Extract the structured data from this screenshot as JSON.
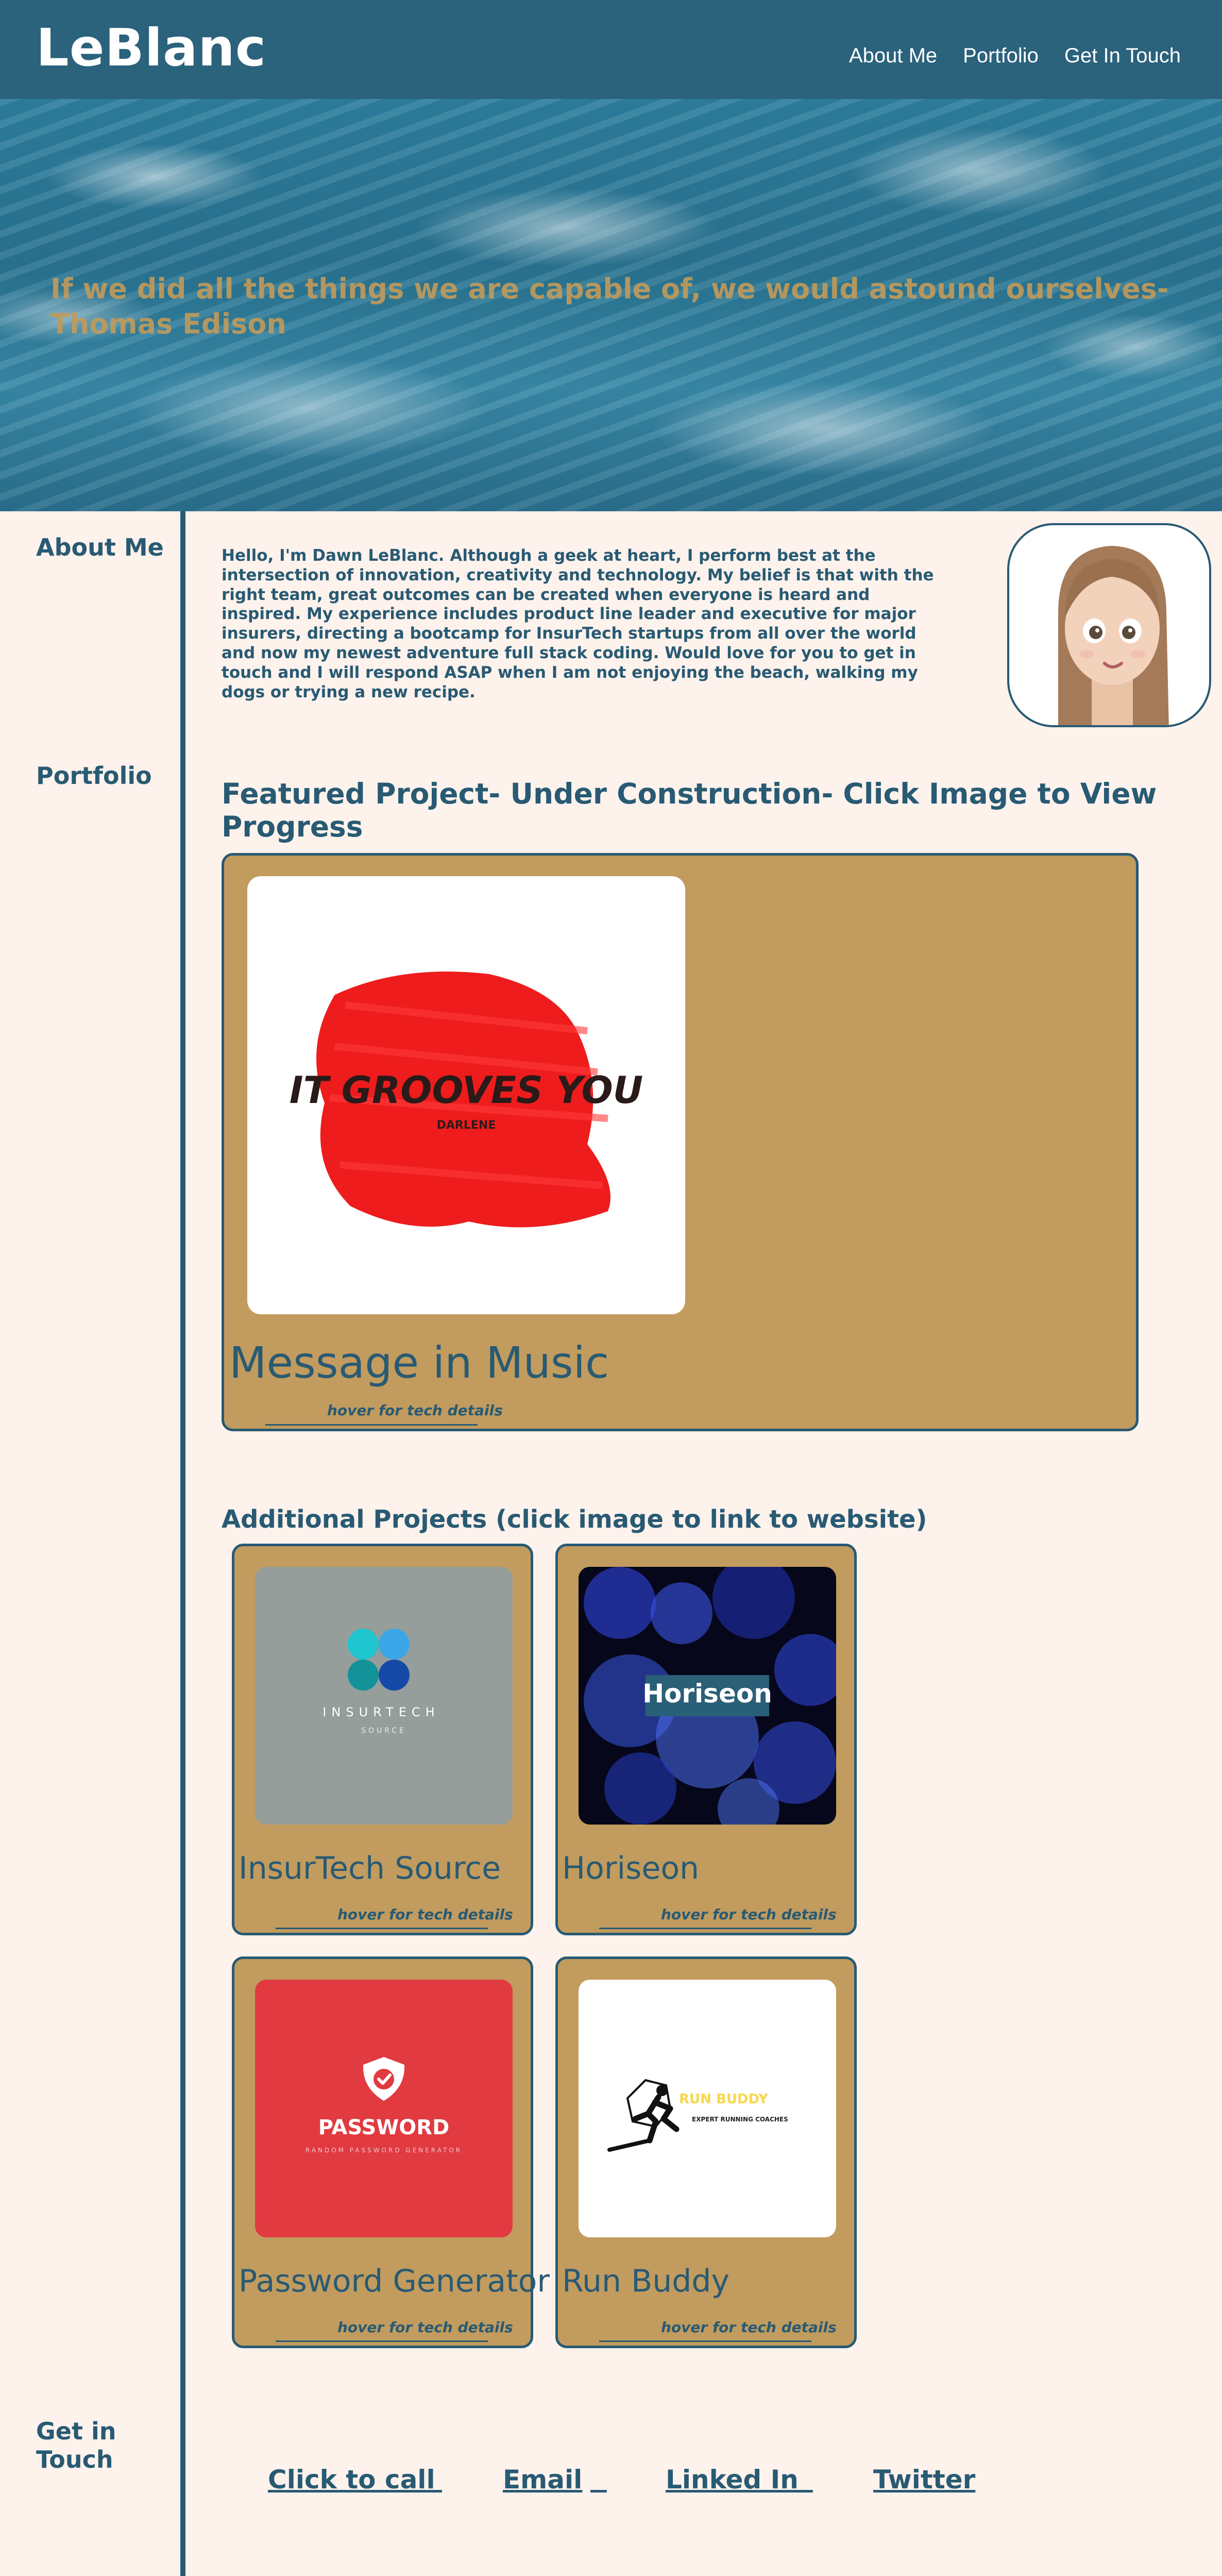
{
  "header": {
    "brand": "LeBlanc",
    "nav": [
      "About Me",
      "Portfolio",
      "Get In Touch"
    ]
  },
  "hero": {
    "quote": "If we did all the things we are capable of, we would astound ourselves- Thomas Edison"
  },
  "sections": {
    "about": "About Me",
    "portfolio": "Portfolio",
    "contact": "Get in Touch"
  },
  "about": {
    "text": "Hello, I'm Dawn LeBlanc.  Although a geek at heart, I perform best at the intersection of innovation, creativity and technology.  My belief is that with the right team, great outcomes can be created when everyone is heard and inspired.  My experience includes product line leader and executive for major insurers, directing a bootcamp for InsurTech startups from all over the world and now my newest adventure full stack coding.  Would love for you to get in touch and I will respond ASAP when I am not enjoying the beach, walking my dogs or trying a new recipe."
  },
  "featured": {
    "heading": "Featured Project- Under Construction- Click Image to View Progress",
    "title": "Message in Music",
    "hover": "hover for tech details",
    "logo_text": "IT GROOVES YOU",
    "logo_sub": "DARLENE"
  },
  "additional": {
    "heading": "Additional Projects (click image to link to website)",
    "projects": [
      {
        "title": "InsurTech Source",
        "hover": "hover for tech details",
        "logo": "INSURTECH",
        "logo_sub": "SOURCE"
      },
      {
        "title": "Horiseon",
        "hover": "hover for tech details",
        "logo": "Horiseon"
      },
      {
        "title": "Password Generator",
        "hover": "hover for tech details",
        "logo": "PASSWORD",
        "logo_sub": "RANDOM PASSWORD GENERATOR"
      },
      {
        "title": "Run Buddy",
        "hover": "hover for tech details",
        "logo": "RUN BUDDY",
        "logo_sub": "EXPERT RUNNING COACHES"
      }
    ]
  },
  "contact": {
    "links": [
      "Click to call",
      "Email",
      "Linked In",
      "Twitter"
    ]
  },
  "colors": {
    "header": "#2b627c",
    "accent": "#c29b5e",
    "background": "#fdf2ec",
    "text": "#285a73"
  }
}
